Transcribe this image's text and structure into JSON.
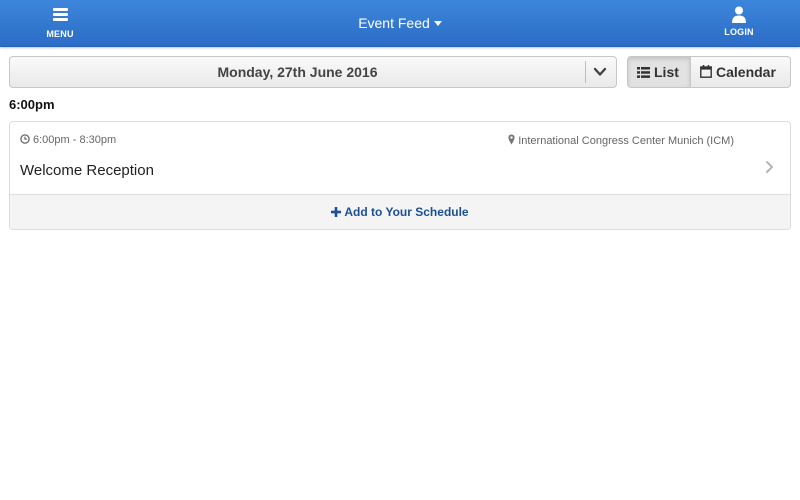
{
  "header": {
    "menu_label": "MENU",
    "menu_icon": "hamburger-icon",
    "title": "Event Feed",
    "login_label": "LOGIN",
    "login_icon": "user-icon",
    "accent_color": "#2f74d0"
  },
  "date_selector": {
    "selected_date": "Monday, 27th June 2016",
    "icon": "chevron-down-icon"
  },
  "view_toggle": {
    "list_label": "List",
    "calendar_label": "Calendar",
    "active": "List"
  },
  "schedule": {
    "time_heading": "6:00pm",
    "events": [
      {
        "time_range": "6:00pm - 8:30pm",
        "location": "International Congress Center Munich (ICM)",
        "title": "Welcome Reception",
        "action_label": "Add to Your Schedule"
      }
    ]
  }
}
